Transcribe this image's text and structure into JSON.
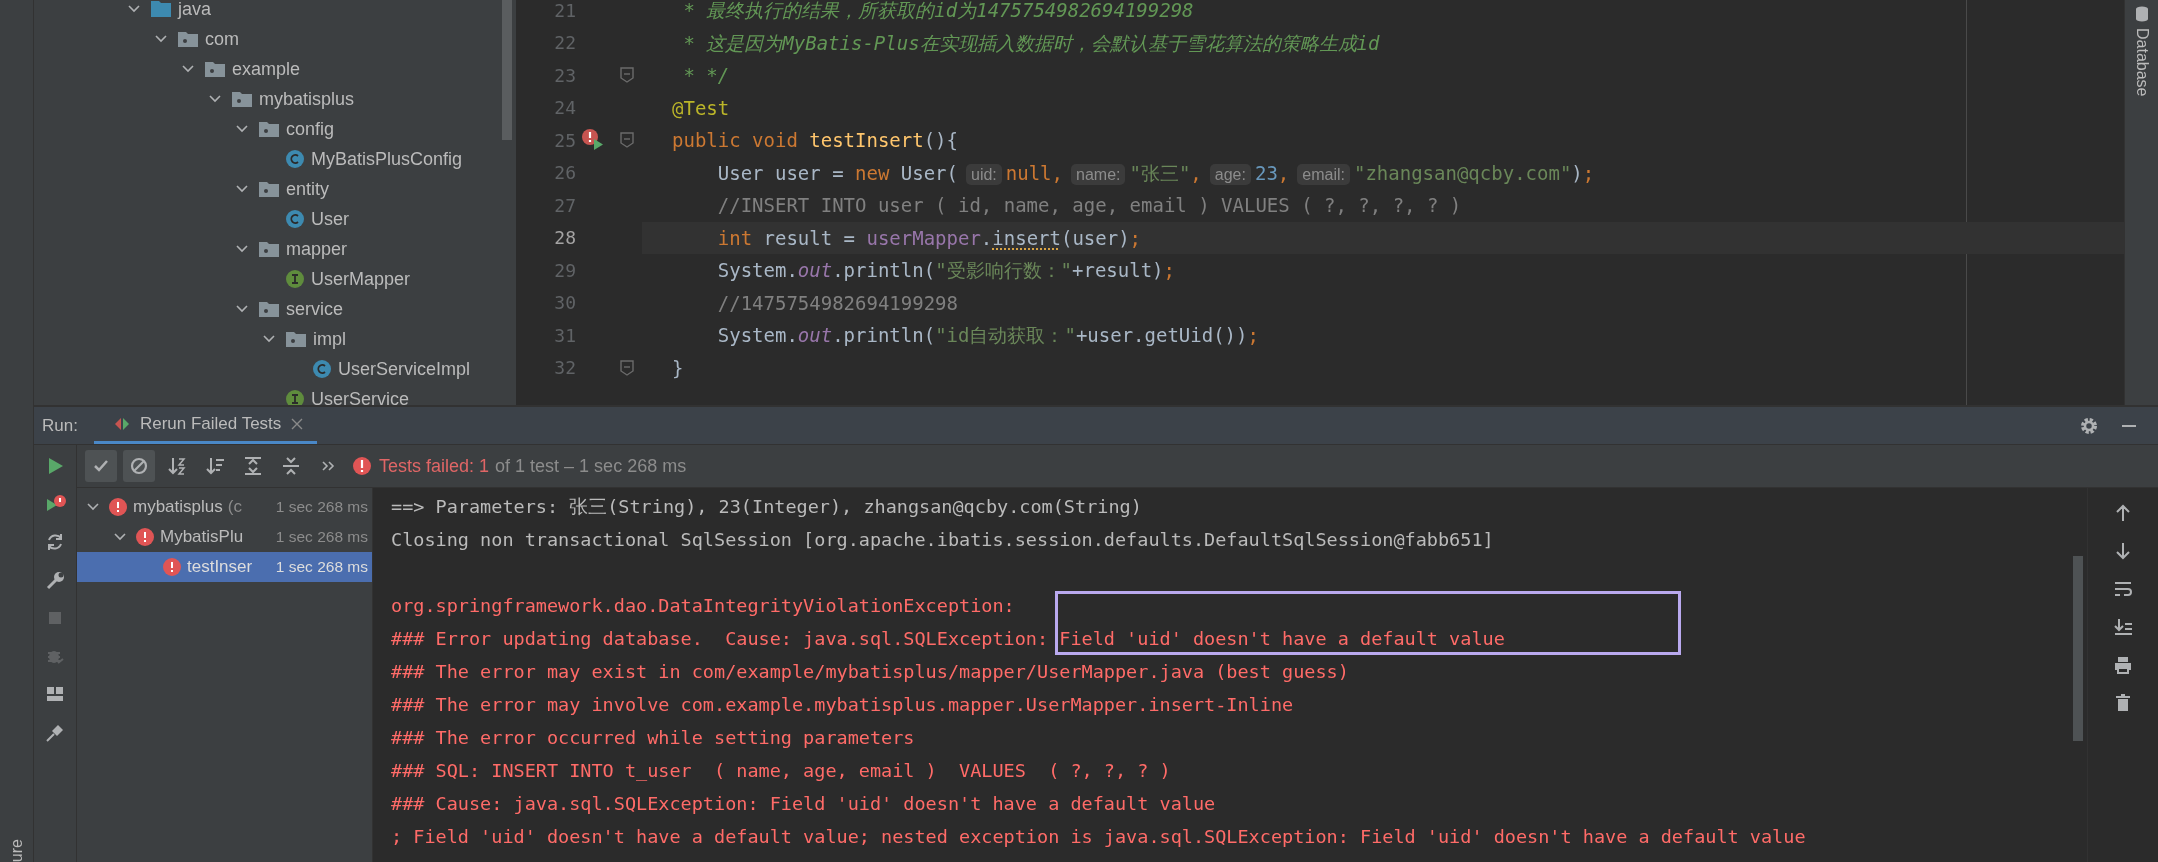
{
  "project_tree": [
    {
      "label": "java",
      "kind": "source-folder",
      "expanded": true,
      "children": [
        {
          "label": "com",
          "kind": "package",
          "expanded": true,
          "children": [
            {
              "label": "example",
              "kind": "package",
              "expanded": true,
              "children": [
                {
                  "label": "mybatisplus",
                  "kind": "package",
                  "expanded": true,
                  "children": [
                    {
                      "label": "config",
                      "kind": "package",
                      "expanded": true,
                      "children": [
                        {
                          "label": "MyBatisPlusConfig",
                          "kind": "class"
                        }
                      ]
                    },
                    {
                      "label": "entity",
                      "kind": "package",
                      "expanded": true,
                      "children": [
                        {
                          "label": "User",
                          "kind": "class"
                        }
                      ]
                    },
                    {
                      "label": "mapper",
                      "kind": "package",
                      "expanded": true,
                      "children": [
                        {
                          "label": "UserMapper",
                          "kind": "interface"
                        }
                      ]
                    },
                    {
                      "label": "service",
                      "kind": "package",
                      "expanded": true,
                      "children": [
                        {
                          "label": "impl",
                          "kind": "package",
                          "expanded": true,
                          "children": [
                            {
                              "label": "UserServiceImpl",
                              "kind": "class"
                            }
                          ]
                        },
                        {
                          "label": "UserService",
                          "kind": "interface"
                        }
                      ]
                    }
                  ]
                }
              ]
            }
          ]
        }
      ]
    }
  ],
  "editor": {
    "lines": [
      {
        "number": "21",
        "current": false,
        "fold": false,
        "failed_test": false,
        "tokens": [
          {
            "kind": "doc",
            "text": " * 最终执行的结果，所获取的id为1475754982694199298"
          }
        ]
      },
      {
        "number": "22",
        "current": false,
        "fold": false,
        "failed_test": false,
        "tokens": [
          {
            "kind": "doc",
            "text": " * 这是因为MyBatis-Plus在实现插入数据时，会默认基于雪花算法的策略生成id"
          }
        ]
      },
      {
        "number": "23",
        "current": false,
        "fold": true,
        "failed_test": false,
        "tokens": [
          {
            "kind": "doc",
            "text": " * */"
          }
        ]
      },
      {
        "number": "24",
        "current": false,
        "fold": false,
        "failed_test": false,
        "tokens": [
          {
            "kind": "annotation",
            "text": "@Test"
          }
        ]
      },
      {
        "number": "25",
        "current": false,
        "fold": true,
        "failed_test": true,
        "tokens": [
          {
            "kind": "keyword",
            "text": "public void "
          },
          {
            "kind": "method",
            "text": "testInsert"
          },
          {
            "kind": "plain",
            "text": "(){"
          }
        ]
      },
      {
        "number": "26",
        "current": false,
        "fold": false,
        "failed_test": false,
        "tokens": [
          {
            "kind": "plain",
            "text": "    User user = "
          },
          {
            "kind": "keyword",
            "text": "new"
          },
          {
            "kind": "plain",
            "text": " User("
          },
          {
            "kind": "hint",
            "text": "uid:"
          },
          {
            "kind": "keyword",
            "text": "null,"
          },
          {
            "kind": "hint",
            "text": "name:"
          },
          {
            "kind": "string",
            "text": "\"张三\""
          },
          {
            "kind": "keyword",
            "text": ","
          },
          {
            "kind": "hint",
            "text": "age:"
          },
          {
            "kind": "number",
            "text": "23"
          },
          {
            "kind": "keyword",
            "text": ","
          },
          {
            "kind": "hint",
            "text": "email:"
          },
          {
            "kind": "string",
            "text": "\"zhangsan@qcby.com\""
          },
          {
            "kind": "plain",
            "text": ")"
          },
          {
            "kind": "keyword",
            "text": ";"
          }
        ]
      },
      {
        "number": "27",
        "current": false,
        "fold": false,
        "failed_test": false,
        "tokens": [
          {
            "kind": "comment",
            "text": "    //INSERT INTO user ( id, name, age, email ) VALUES ( ?, ?, ?, ? )"
          }
        ]
      },
      {
        "number": "28",
        "current": true,
        "fold": false,
        "failed_test": false,
        "tokens": [
          {
            "kind": "keyword",
            "text": "    int"
          },
          {
            "kind": "plain",
            "text": " result = "
          },
          {
            "kind": "member",
            "text": "userMapper"
          },
          {
            "kind": "plain",
            "text": "."
          },
          {
            "kind": "warn",
            "text": "insert"
          },
          {
            "kind": "plain",
            "text": "(user)"
          },
          {
            "kind": "keyword",
            "text": ";"
          }
        ]
      },
      {
        "number": "29",
        "current": false,
        "fold": false,
        "failed_test": false,
        "tokens": [
          {
            "kind": "plain",
            "text": "    System."
          },
          {
            "kind": "static",
            "text": "out"
          },
          {
            "kind": "plain",
            "text": ".println("
          },
          {
            "kind": "string",
            "text": "\"受影响行数：\""
          },
          {
            "kind": "plain",
            "text": "+result)"
          },
          {
            "kind": "keyword",
            "text": ";"
          }
        ]
      },
      {
        "number": "30",
        "current": false,
        "fold": false,
        "failed_test": false,
        "tokens": [
          {
            "kind": "comment",
            "text": "    //1475754982694199298"
          }
        ]
      },
      {
        "number": "31",
        "current": false,
        "fold": false,
        "failed_test": false,
        "tokens": [
          {
            "kind": "plain",
            "text": "    System."
          },
          {
            "kind": "static",
            "text": "out"
          },
          {
            "kind": "plain",
            "text": ".println("
          },
          {
            "kind": "string",
            "text": "\"id自动获取：\""
          },
          {
            "kind": "plain",
            "text": "+user.getUid())"
          },
          {
            "kind": "keyword",
            "text": ";"
          }
        ]
      },
      {
        "number": "32",
        "current": false,
        "fold": true,
        "failed_test": false,
        "tokens": [
          {
            "kind": "plain",
            "text": "}"
          }
        ]
      }
    ]
  },
  "right_strip": {
    "label": "Database"
  },
  "left_strip": {
    "label": "ure"
  },
  "run_panel": {
    "title": "Run:",
    "tab": {
      "label": "Rerun Failed Tests",
      "selected": true
    },
    "side_tools": [
      {
        "kind": "run",
        "disabled": false
      },
      {
        "kind": "rerun-failed",
        "disabled": false
      },
      {
        "kind": "auto-rerun",
        "disabled": false
      },
      {
        "kind": "settings",
        "disabled": false
      },
      {
        "kind": "stop",
        "disabled": true
      },
      {
        "kind": "debug",
        "disabled": true
      },
      {
        "kind": "layout",
        "disabled": false
      },
      {
        "kind": "pin",
        "disabled": false
      }
    ],
    "toolbar": [
      {
        "kind": "show-passed",
        "on": true
      },
      {
        "kind": "show-ignored",
        "on": true
      },
      {
        "kind": "sort-alpha",
        "on": false
      },
      {
        "kind": "sort-duration",
        "on": false
      },
      {
        "kind": "expand-all",
        "on": false
      },
      {
        "kind": "collapse-all",
        "on": false
      },
      {
        "kind": "more",
        "on": false
      }
    ],
    "status": {
      "failed": "Tests failed: 1",
      "detail": "of 1 test – 1 sec 268 ms"
    },
    "tests": [
      {
        "label": "mybatisplus",
        "suffix": "(c",
        "time": "1 sec 268 ms",
        "failed": true,
        "expanded": true,
        "selected": false,
        "children": [
          {
            "label": "MybatisPlu",
            "time": "1 sec 268 ms",
            "failed": true,
            "expanded": true,
            "selected": false,
            "children": [
              {
                "label": "testInser",
                "time": "1 sec 268 ms",
                "failed": true,
                "selected": true
              }
            ]
          }
        ]
      }
    ],
    "console": [
      {
        "kind": "info",
        "text": "==> Parameters: 张三(String), 23(Integer), zhangsan@qcby.com(String)"
      },
      {
        "kind": "info",
        "text": "Closing non transactional SqlSession [org.apache.ibatis.session.defaults.DefaultSqlSession@fabb651]"
      },
      {
        "kind": "blank"
      },
      {
        "kind": "error",
        "text": "org.springframework.dao.DataIntegrityViolationException: "
      },
      {
        "kind": "error",
        "text": "### Error updating database.  Cause: java.sql.SQLException: Field 'uid' doesn't have a default value"
      },
      {
        "kind": "error",
        "text": "### The error may exist in com/example/mybatisplus/mapper/UserMapper.java (best guess)"
      },
      {
        "kind": "error",
        "text": "### The error may involve com.example.mybatisplus.mapper.UserMapper.insert-Inline"
      },
      {
        "kind": "error",
        "text": "### The error occurred while setting parameters"
      },
      {
        "kind": "error",
        "text": "### SQL: INSERT INTO t_user  ( name, age, email )  VALUES  ( ?, ?, ? )"
      },
      {
        "kind": "error",
        "text": "### Cause: java.sql.SQLException: Field 'uid' doesn't have a default value"
      },
      {
        "kind": "error",
        "text": "; Field 'uid' doesn't have a default value; nested exception is java.sql.SQLException: Field 'uid' doesn't have a default value"
      }
    ],
    "console_tools": [
      {
        "kind": "up"
      },
      {
        "kind": "down"
      },
      {
        "kind": "wrap"
      },
      {
        "kind": "scroll-end"
      },
      {
        "kind": "print"
      },
      {
        "kind": "trash"
      }
    ],
    "panel_actions": [
      {
        "kind": "settings"
      },
      {
        "kind": "minimize"
      }
    ]
  }
}
